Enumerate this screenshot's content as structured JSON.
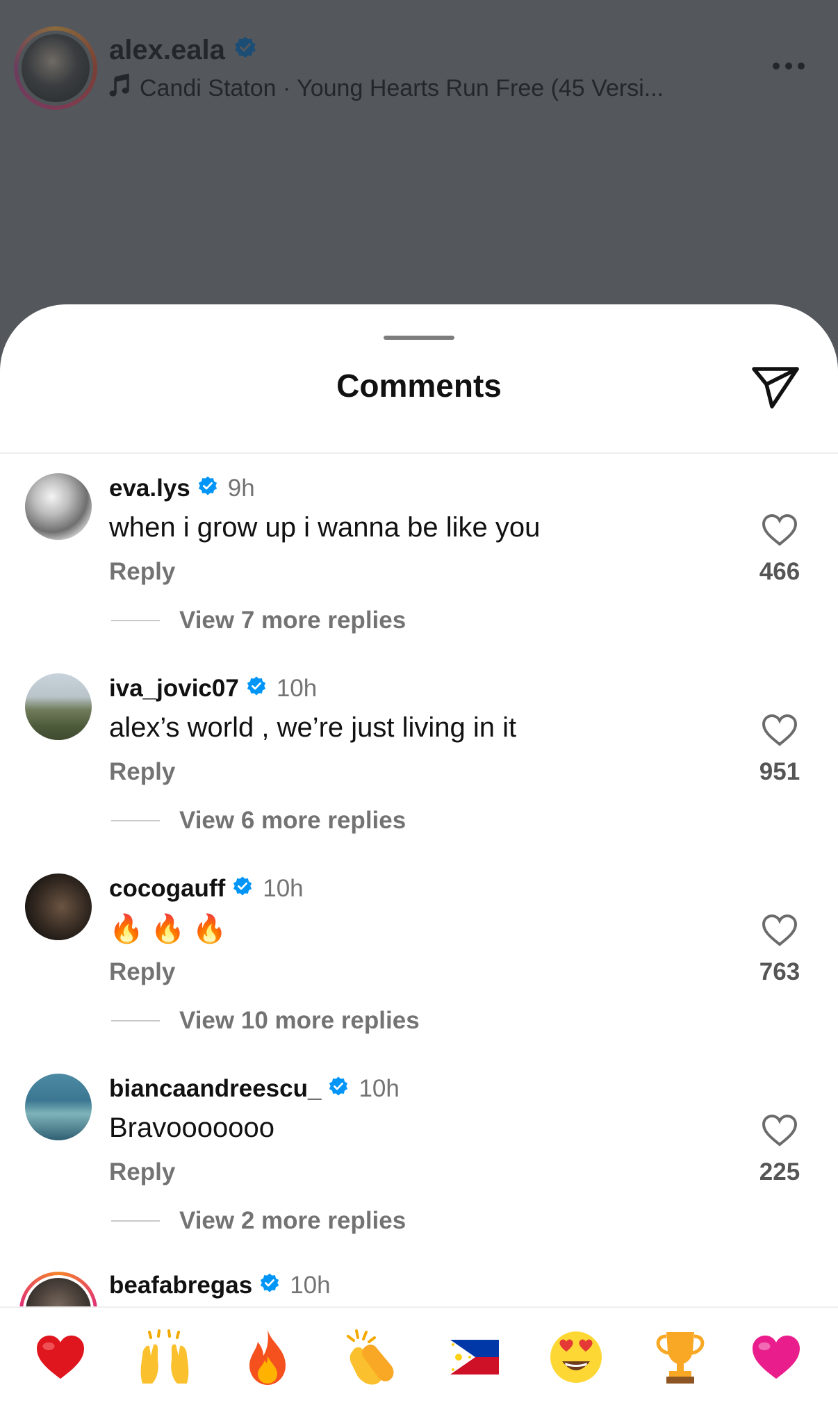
{
  "post": {
    "username": "alex.eala",
    "music": "Candi Staton · Young Hearts Run Free (45 Versi..."
  },
  "sheet": {
    "title": "Comments"
  },
  "comments": [
    {
      "username": "eva.lys",
      "time": "9h",
      "text": "when i grow up i wanna be like you",
      "reply_label": "Reply",
      "likes": "466",
      "view_replies": "View 7 more replies"
    },
    {
      "username": "iva_jovic07",
      "time": "10h",
      "text": "alex’s world , we’re just living in it",
      "reply_label": "Reply",
      "likes": "951",
      "view_replies": "View 6 more replies"
    },
    {
      "username": "cocogauff",
      "time": "10h",
      "text": "🔥🔥🔥",
      "reply_label": "Reply",
      "likes": "763",
      "view_replies": "View 10 more replies"
    },
    {
      "username": "biancaandreescu_",
      "time": "10h",
      "text": "Bravooooooo",
      "reply_label": "Reply",
      "likes": "225",
      "view_replies": "View 2 more replies"
    }
  ],
  "partial_comment": {
    "username": "beafabregas",
    "time": "10h"
  },
  "emoji_bar": [
    "red-heart",
    "raising-hands",
    "fire",
    "clapping-hands",
    "philippines-flag",
    "heart-eyes-face",
    "trophy",
    "pink-heart"
  ],
  "colors": {
    "verified": "#0095f6",
    "sheet_bg": "#ffffff",
    "dim_bg": "#54585d",
    "secondary_text": "#737373"
  }
}
